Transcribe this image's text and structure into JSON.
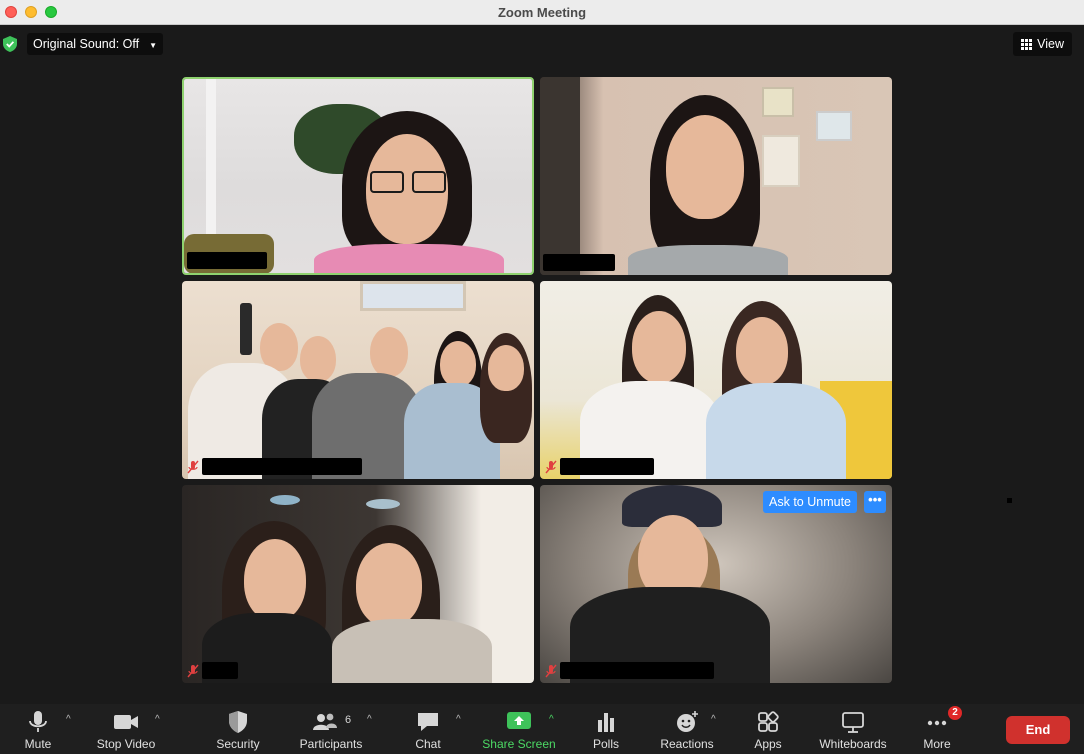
{
  "window": {
    "title": "Zoom Meeting"
  },
  "topbar": {
    "original_sound": "Original Sound: Off",
    "view": "View"
  },
  "tiles": [
    {
      "active_speaker": true,
      "muted": false
    },
    {
      "active_speaker": false,
      "muted": false
    },
    {
      "active_speaker": false,
      "muted": true
    },
    {
      "active_speaker": false,
      "muted": true
    },
    {
      "active_speaker": false,
      "muted": true
    },
    {
      "active_speaker": false,
      "muted": true,
      "ask_to_unmute": "Ask to Unmute",
      "more": "•••"
    }
  ],
  "toolbar": {
    "mute": "Mute",
    "stop_video": "Stop Video",
    "security": "Security",
    "participants": "Participants",
    "participants_count": "6",
    "chat": "Chat",
    "share_screen": "Share Screen",
    "polls": "Polls",
    "reactions": "Reactions",
    "apps": "Apps",
    "whiteboards": "Whiteboards",
    "more": "More",
    "more_badge": "2",
    "end": "End"
  },
  "colors": {
    "active_border": "#8fd26f",
    "share_green": "#4cd964",
    "end_red": "#d0312d",
    "zoom_blue": "#2d8cff"
  }
}
